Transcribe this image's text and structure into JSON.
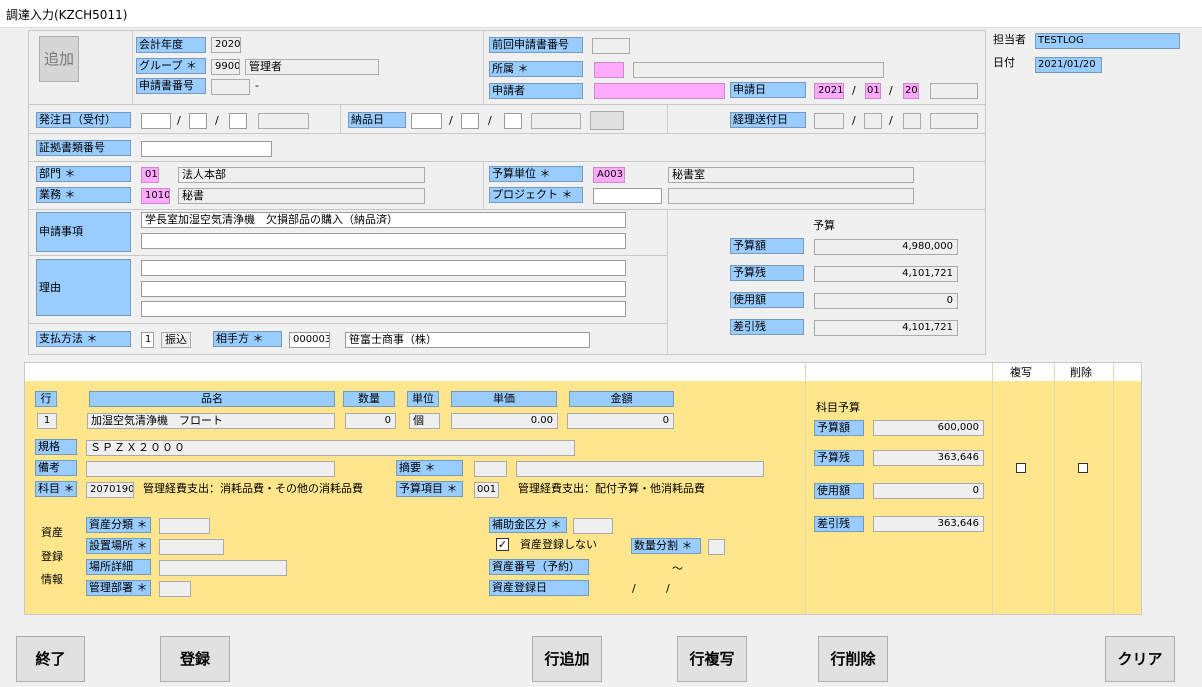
{
  "window": {
    "title": "調達入力(KZCH5011)"
  },
  "header": {
    "add_button": "追加",
    "fiscal_year_label": "会計年度",
    "fiscal_year": "2020",
    "group_label": "グループ ＊",
    "group_code": "9900",
    "group_name": "管理者",
    "request_no_label": "申請書番号",
    "request_no": "",
    "request_no_suffix": "-",
    "prev_request_label": "前回申請書番号",
    "prev_request": "",
    "affiliation_label": "所属 ＊",
    "affiliation_code": "",
    "affiliation_name": "",
    "applicant_label": "申請者",
    "applicant": "",
    "apply_date_label": "申請日",
    "apply_year": "2021",
    "apply_month": "01",
    "apply_day": "20",
    "date_sep": "/",
    "owner_label": "担当者",
    "owner": "TESTLOG",
    "date_label": "日付",
    "date": "2021/01/20"
  },
  "dates": {
    "order_date_label": "発注日（受付）",
    "delivery_date_label": "納品日",
    "accounting_date_label": "経理送付日",
    "voucher_label": "証拠書類番号"
  },
  "dept": {
    "dept_label": "部門 ＊",
    "dept_code": "01",
    "dept_name": "法人本部",
    "work_label": "業務 ＊",
    "work_code": "1010",
    "work_name": "秘書",
    "budget_unit_label": "予算単位 ＊",
    "budget_unit_code": "A003",
    "budget_unit_name": "秘書室",
    "project_label": "プロジェクト ＊",
    "project_code": "",
    "project_name": ""
  },
  "request": {
    "matter_label": "申請事項",
    "matter_line1": "学長室加湿空気清浄機　欠損部品の購入（納品済）",
    "reason_label": "理由",
    "payment_label": "支払方法 ＊",
    "payment_code": "1",
    "payment_name": "振込",
    "partner_label": "相手方 ＊",
    "partner_code": "000003",
    "partner_name": "笹富士商事（株）"
  },
  "budget": {
    "title": "予算",
    "amount_label": "予算額",
    "amount": "4,980,000",
    "remain_label": "予算残",
    "remain": "4,101,721",
    "used_label": "使用額",
    "used": "0",
    "balance_label": "差引残",
    "balance": "4,101,721"
  },
  "detail": {
    "copy_header": "複写",
    "delete_header": "削除",
    "row_label": "行",
    "item_label": "品名",
    "qty_label": "数量",
    "unit_label": "単位",
    "price_label": "単価",
    "amount_label": "金額",
    "row_no": "1",
    "item_name": "加湿空気清浄機　フロート",
    "qty": "0",
    "unit": "個",
    "price": "0.00",
    "amount": "0",
    "spec_label": "規格",
    "spec": "ＳＰＺＸ２０００",
    "note_label": "備考",
    "note": "",
    "summary_label": "摘要 ＊",
    "subject_label": "科目 ＊",
    "subject_code": "2070190",
    "subject_name": "管理経費支出：消耗品費・その他の消耗品費",
    "budget_item_label": "予算項目 ＊",
    "budget_item_code": "001",
    "budget_item_name": "管理経費支出：配付予算・他消耗品費",
    "asset_caption_1": "資産",
    "asset_caption_2": "登録",
    "asset_caption_3": "情報",
    "asset_class_label": "資産分類 ＊",
    "location_label": "設置場所 ＊",
    "location_detail_label": "場所詳細",
    "mgmt_dept_label": "管理部署 ＊",
    "subsidy_label": "補助金区分 ＊",
    "no_register_label": "資産登録しない",
    "qty_split_label": "数量分割 ＊",
    "asset_no_label": "資産番号（予約）",
    "tilde": "～",
    "asset_date_label": "資産登録日",
    "asset_date_sep1": "/",
    "asset_date_sep2": "/",
    "subject_budget_title": "科目予算",
    "sb_amount_label": "予算額",
    "sb_amount": "600,000",
    "sb_remain_label": "予算残",
    "sb_remain": "363,646",
    "sb_used_label": "使用額",
    "sb_used": "0",
    "sb_balance_label": "差引残",
    "sb_balance": "363,646"
  },
  "footer": {
    "exit": "終了",
    "register": "登録",
    "add_row": "行追加",
    "copy_row": "行複写",
    "delete_row": "行削除",
    "clear": "クリア"
  }
}
